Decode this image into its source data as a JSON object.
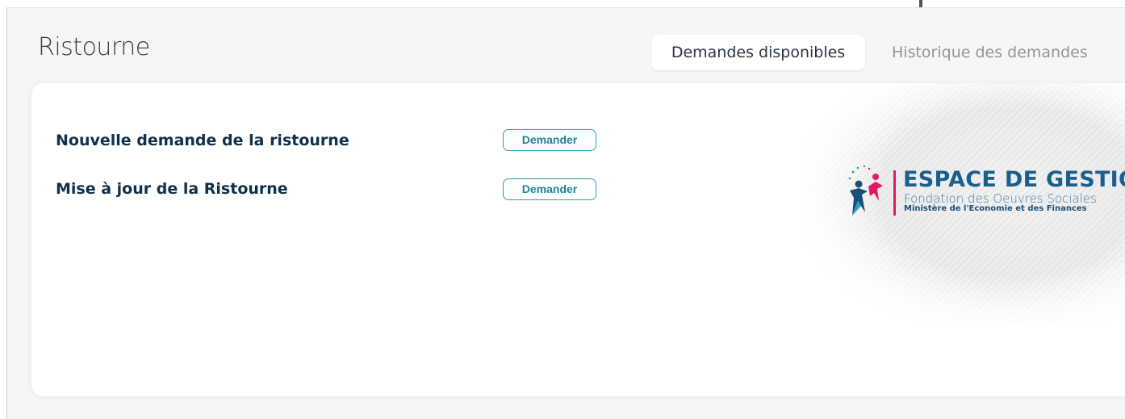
{
  "page": {
    "title": "Ristourne"
  },
  "tabs": [
    {
      "label": "Demandes disponibles",
      "active": true
    },
    {
      "label": "Historique des demandes",
      "active": false
    }
  ],
  "requests": [
    {
      "label": "Nouvelle demande de la ristourne",
      "button_label": "Demander"
    },
    {
      "label": "Mise à jour de la Ristourne",
      "button_label": "Demander"
    }
  ],
  "logo": {
    "title": "ESPACE DE GESTION",
    "subtitle": "Fondation des Oeuvres Sociales",
    "ministry": "Ministère de l'Economie et des Finances",
    "icon": "people-emblem-icon"
  },
  "colors": {
    "accent": "#2aa0b8",
    "title_text": "#10304c",
    "logo_blue": "#1b5f8c",
    "logo_pink": "#e01a5e"
  }
}
